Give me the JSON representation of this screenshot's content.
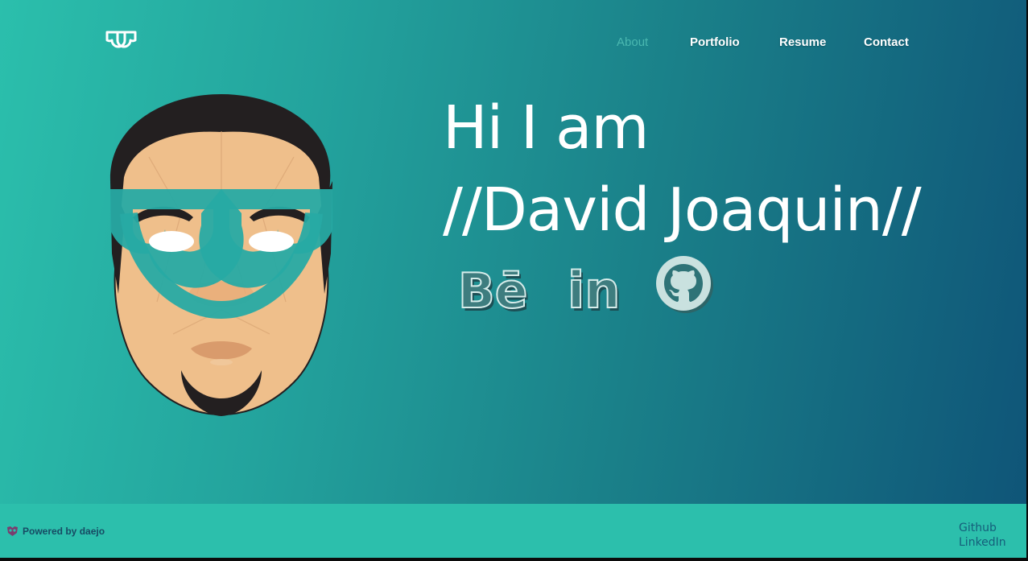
{
  "header": {
    "logo_icon": "dj-monogram-logo",
    "nav": [
      {
        "label": "About",
        "active": true
      },
      {
        "label": "Portfolio",
        "active": false
      },
      {
        "label": "Resume",
        "active": false
      },
      {
        "label": "Contact",
        "active": false
      }
    ]
  },
  "hero": {
    "line1": "Hi I am",
    "line2": "//David Joaquin//",
    "avatar_icon": "illustrated-face-avatar",
    "social": [
      {
        "name": "Behance",
        "icon": "behance-icon"
      },
      {
        "name": "LinkedIn",
        "icon": "linkedin-icon"
      },
      {
        "name": "GitHub",
        "icon": "github-icon"
      }
    ]
  },
  "footer": {
    "powered_by": "Powered by daejo",
    "powered_icon": "daejo-mask-icon",
    "links": [
      "Github",
      "LinkedIn"
    ]
  },
  "colors": {
    "gradient_start": "#2bbfac",
    "gradient_end": "#0f5578",
    "footer_bg": "#2cbfac",
    "active_nav": "#4ab8b0"
  }
}
